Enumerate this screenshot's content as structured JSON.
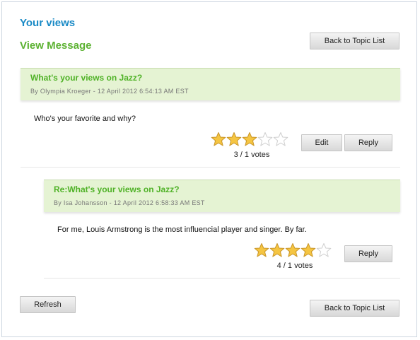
{
  "header": {
    "app_title": "Your views",
    "view_title": "View Message",
    "back_label": "Back to Topic List"
  },
  "messages": [
    {
      "subject": "What's your views on Jazz?",
      "meta": "By Olympia Kroeger - 12 April 2012 6:54:13 AM EST",
      "body": "Who's your favorite and why?",
      "rating": 3,
      "max_rating": 5,
      "votes": "3 / 1 votes",
      "edit_label": "Edit",
      "reply_label": "Reply"
    },
    {
      "subject": "Re:What's your views on Jazz?",
      "meta": "By Isa Johansson - 12 April 2012 6:58:33 AM EST",
      "body": "For me, Louis Armstrong is the most influencial player and singer. By far.",
      "rating": 4,
      "max_rating": 5,
      "votes": "4 / 1 votes",
      "reply_label": "Reply"
    }
  ],
  "footer": {
    "refresh_label": "Refresh",
    "back_label": "Back to Topic List"
  },
  "colors": {
    "star_filled": "#f5c542",
    "star_empty": "#ffffff",
    "accent_blue": "#1a8ac6",
    "accent_green": "#5cb232"
  }
}
